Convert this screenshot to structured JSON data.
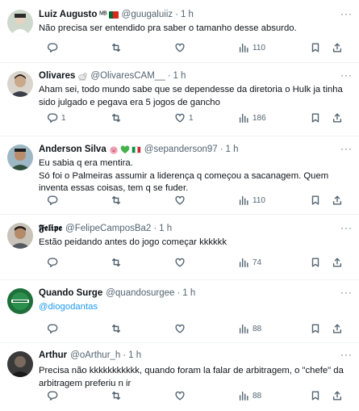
{
  "tweets": [
    {
      "name": "Luiz Augusto",
      "extra": "ᴹᴮ",
      "handle": "@guugaluiiz",
      "time": "1 h",
      "text": "Não precisa ser entendido pra saber o tamanho desse absurdo.",
      "replies": "",
      "retweets": "",
      "likes": "",
      "views": "110"
    },
    {
      "name": "Olivares",
      "handle": "@OlivaresCAM__",
      "time": "1 h",
      "text": "Aham sei, todo mundo sabe que se dependesse da diretoria o Hulk ja tinha sido julgado e pegava era 5 jogos de gancho",
      "replies": "1",
      "retweets": "",
      "likes": "1",
      "views": "186"
    },
    {
      "name": "Anderson Silva",
      "handle": "@sepanderson97",
      "time": "1 h",
      "text": "Eu sabia q era mentira.\nSó foi o Palmeiras assumir a liderença q começou a sacanagem. Quem inventa essas coisas, tem q se fuder.",
      "replies": "",
      "retweets": "",
      "likes": "",
      "views": "110"
    },
    {
      "name": "𝕱𝖊𝖑𝖎𝖕𝖊",
      "handle": "@FelipeCamposBa2",
      "time": "1 h",
      "text": "Estão peidando antes do jogo começar kkkkkk",
      "replies": "",
      "retweets": "",
      "likes": "",
      "views": "74"
    },
    {
      "name": "Quando Surge",
      "handle": "@quandosurgee",
      "time": "1 h",
      "text": "@diogodantas",
      "replies": "",
      "retweets": "",
      "likes": "",
      "views": "88"
    },
    {
      "name": "Arthur",
      "handle": "@oArthur_h",
      "time": "1 h",
      "text": "Precisa não kkkkkkkkkkk, quando foram la falar de arbitragem, o \"chefe\" da arbitragem preferiu n ir",
      "replies": "",
      "retweets": "",
      "likes": "",
      "views": "88"
    }
  ],
  "ui": {
    "dot": "·",
    "more": "···",
    "hearts": "🐷",
    "green_heart": "💚"
  },
  "colors": {
    "text": "#0f1419",
    "secondary": "#536471",
    "link": "#1d9bf0",
    "divider": "#eff3f4"
  }
}
